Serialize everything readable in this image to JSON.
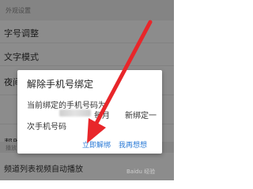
{
  "settings": {
    "section_header": "外观设置",
    "font_size_label": "字号调整",
    "text_mode_label": "文字模式",
    "night_label_partial": "夜间",
    "help_label_partial": "帮助",
    "playback_header_partial": "播放",
    "video_autoplay_label": "频道列表视频自动播放"
  },
  "dialog": {
    "title": "解除手机号绑定",
    "message_line1": "当前绑定的手机号码为",
    "message_line2_a": "每月",
    "message_line2_b": "新绑定一",
    "message_line3": "次手机号码",
    "confirm_button": "立即解绑",
    "cancel_button": "我再想想"
  },
  "watermark": "Baidu 经验",
  "colors": {
    "accent": "#2a7ad6",
    "arrow": "#e8262a",
    "overlay": "rgba(0,0,0,0.45)"
  },
  "icons": {
    "arrow": "red-arrow-annotation"
  }
}
